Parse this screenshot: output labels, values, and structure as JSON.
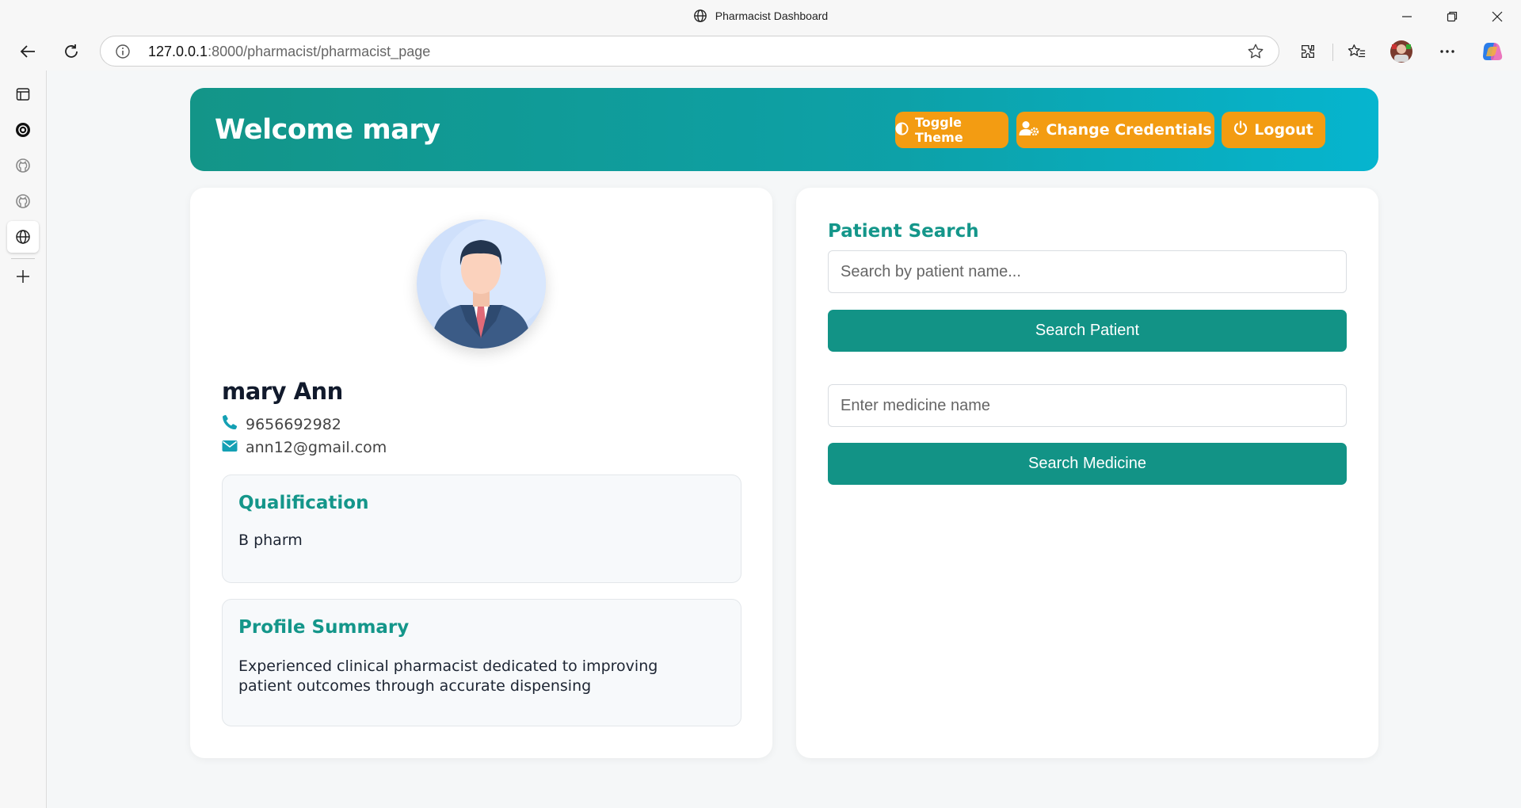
{
  "browser": {
    "window_title": "Pharmacist Dashboard",
    "url_host": "127.0.0.1",
    "url_path": ":8000/pharmacist/pharmacist_page"
  },
  "header": {
    "welcome": "Welcome mary",
    "buttons": {
      "toggle_theme": "Toggle Theme",
      "change_credentials": "Change Credentials",
      "logout": "Logout"
    }
  },
  "profile": {
    "name": "mary Ann",
    "phone": "9656692982",
    "email": "ann12@gmail.com",
    "qualification": {
      "title": "Qualification",
      "value": "B pharm"
    },
    "summary": {
      "title": "Profile Summary",
      "value": "Experienced clinical pharmacist dedicated to improving patient outcomes through accurate dispensing"
    }
  },
  "search": {
    "title": "Patient Search",
    "patient_placeholder": "Search by patient name...",
    "patient_button": "Search Patient",
    "medicine_placeholder": "Enter medicine name",
    "medicine_button": "Search Medicine"
  },
  "colors": {
    "accent": "#139588",
    "header_gradient_end": "#06b5cf",
    "button_orange": "#f39c12"
  }
}
